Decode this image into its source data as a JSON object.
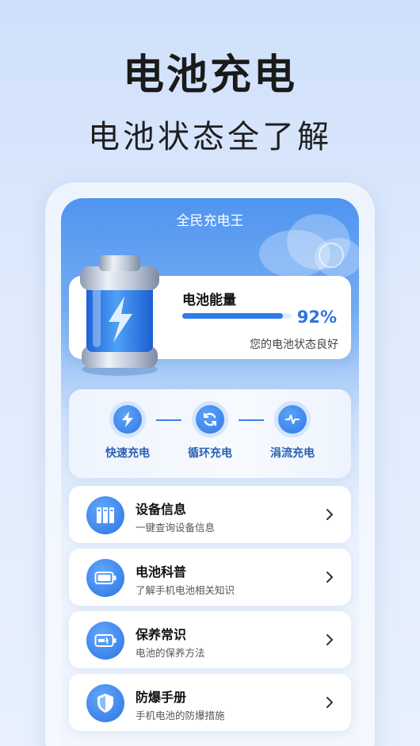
{
  "hero": {
    "title": "电池充电",
    "subtitle": "电池状态全了解"
  },
  "app": {
    "title": "全民充电王"
  },
  "battery": {
    "label": "电池能量",
    "percent_text": "92%",
    "level": 0.92,
    "status": "您的电池状态良好"
  },
  "modes": [
    {
      "label": "快速充电",
      "icon": "lightning-icon"
    },
    {
      "label": "循环充电",
      "icon": "cycle-icon"
    },
    {
      "label": "涓流充电",
      "icon": "pulse-icon"
    }
  ],
  "menu": [
    {
      "title": "设备信息",
      "subtitle": "一键查询设备信息",
      "icon": "device-info-icon"
    },
    {
      "title": "电池科普",
      "subtitle": "了解手机电池相关知识",
      "icon": "battery-icon"
    },
    {
      "title": "保养常识",
      "subtitle": "电池的保养方法",
      "icon": "battery-care-icon"
    },
    {
      "title": "防爆手册",
      "subtitle": "手机电池的防爆措施",
      "icon": "shield-icon"
    }
  ],
  "colors": {
    "accent": "#2f73e0",
    "mode_label": "#2b5fb2"
  }
}
